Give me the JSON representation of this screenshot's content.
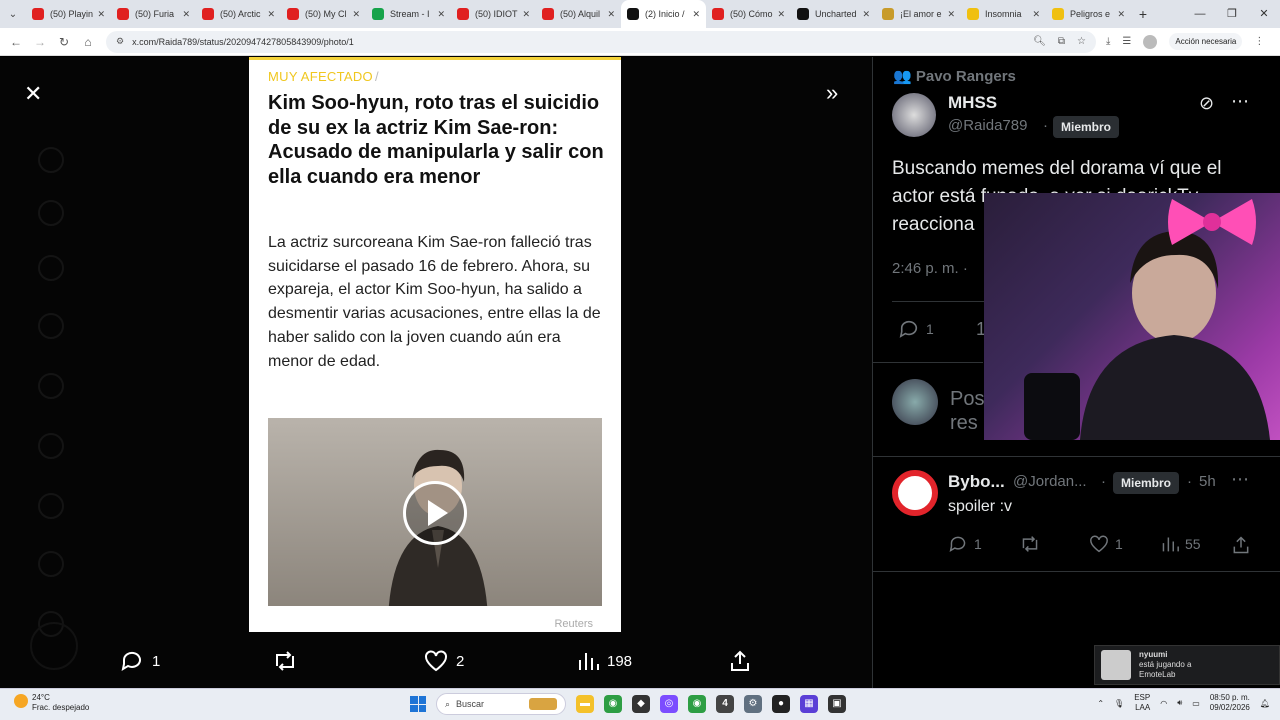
{
  "browser": {
    "tabs": [
      {
        "title": "(50) Playin",
        "color": "#e02020",
        "active": false
      },
      {
        "title": "(50) Furia",
        "color": "#e02020",
        "active": false
      },
      {
        "title": "(50) Arctic",
        "color": "#e02020",
        "active": false
      },
      {
        "title": "(50) My Cl",
        "color": "#e02020",
        "active": false
      },
      {
        "title": "Stream - I",
        "color": "#16a34a",
        "active": false
      },
      {
        "title": "(50) IDIOT",
        "color": "#e02020",
        "active": false
      },
      {
        "title": "(50) Alquil",
        "color": "#e02020",
        "active": false
      },
      {
        "title": "(2) Inicio /",
        "color": "#111111",
        "active": true
      },
      {
        "title": "(50) Cómo",
        "color": "#e02020",
        "active": false
      },
      {
        "title": "Uncharted",
        "color": "#111111",
        "active": false
      },
      {
        "title": "¡El amor e",
        "color": "#c89b2a",
        "active": false
      },
      {
        "title": "Insomnia",
        "color": "#f0c010",
        "active": false
      },
      {
        "title": "Peligros e",
        "color": "#f0c010",
        "active": false
      }
    ],
    "url": "x.com/Raida789/status/2020947427805843909/photo/1",
    "accion": "Acción necesaria"
  },
  "article": {
    "tag": "MUY AFECTADO",
    "headline": "Kim Soo-hyun, roto tras el suicidio de su ex la actriz Kim Sae-ron: Acusado de manipularla y salir con ella cuando era menor",
    "body": "La actriz surcoreana Kim Sae-ron falleció tras suicidarse el pasado 16 de febrero. Ahora, su expareja, el actor Kim Soo-hyun, ha salido a desmentir varias acusaciones, entre ellas la de haber salido con la joven cuando aún era menor de edad.",
    "credit": "Reuters"
  },
  "media_actions": {
    "replies": "1",
    "likes": "2",
    "views": "198"
  },
  "sidebar": {
    "community": "Pavo Rangers",
    "post": {
      "name": "MHSS",
      "handle": "@Raida789",
      "badge": "Miembro",
      "text": "Buscando memes del dorama ví que el actor está funado, a ver si daarickTv reacciona",
      "time": "2:46 p. m. ·",
      "replies": "1",
      "reposts": "1"
    },
    "reply_placeholder": "Pos",
    "reply_placeholder2": "res",
    "reply": {
      "name": "Bybo...",
      "handle": "@Jordan...",
      "badge": "Miembro",
      "age": "5h",
      "text": "spoiler :v",
      "replies": "1",
      "likes": "1",
      "views": "55"
    }
  },
  "notification": {
    "user": "nyuumi",
    "line2": "está jugando a",
    "game": "EmoteLab"
  },
  "taskbar": {
    "temp": "24°C",
    "weather": "Frac. despejado",
    "search": "Buscar",
    "lang1": "ESP",
    "lang2": "LAA",
    "time": "08:50 p. m.",
    "date": "09/02/2026"
  }
}
